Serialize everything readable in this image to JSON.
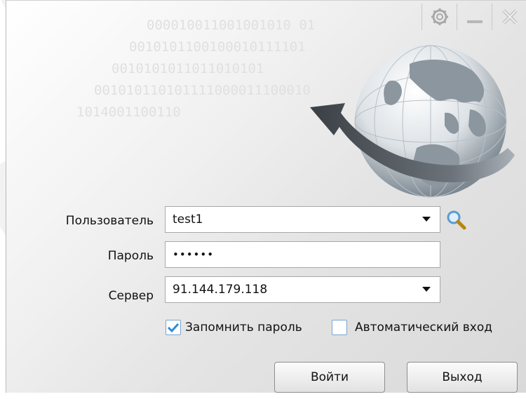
{
  "window": {
    "controls": [
      {
        "name": "settings",
        "icon": "gear-icon"
      },
      {
        "name": "minimize",
        "icon": "minimize-icon"
      },
      {
        "name": "close",
        "icon": "close-icon"
      }
    ]
  },
  "background": {
    "binary_lines": [
      "000010011001001010 01",
      "0010101100100010111101",
      "0010101011011010101",
      "001010110101111000011100010",
      "1014001100110"
    ],
    "logo_icon": "globe-arrow-icon"
  },
  "form": {
    "user": {
      "label": "Пользователь",
      "value": "test1"
    },
    "password": {
      "label": "Пароль",
      "value": "••••••"
    },
    "server": {
      "label": "Сервер",
      "value": "91.144.179.118"
    },
    "remember": {
      "label": "Запомнить пароль",
      "checked": true
    },
    "auto_login": {
      "label": "Автоматический вход",
      "checked": false
    }
  },
  "buttons": {
    "login": "Войти",
    "exit": "Выход"
  },
  "colors": {
    "accent": "#3a85c8",
    "check": "#2e8bd3",
    "globe": "#9aa4ae",
    "arrow": "#3e4348"
  }
}
